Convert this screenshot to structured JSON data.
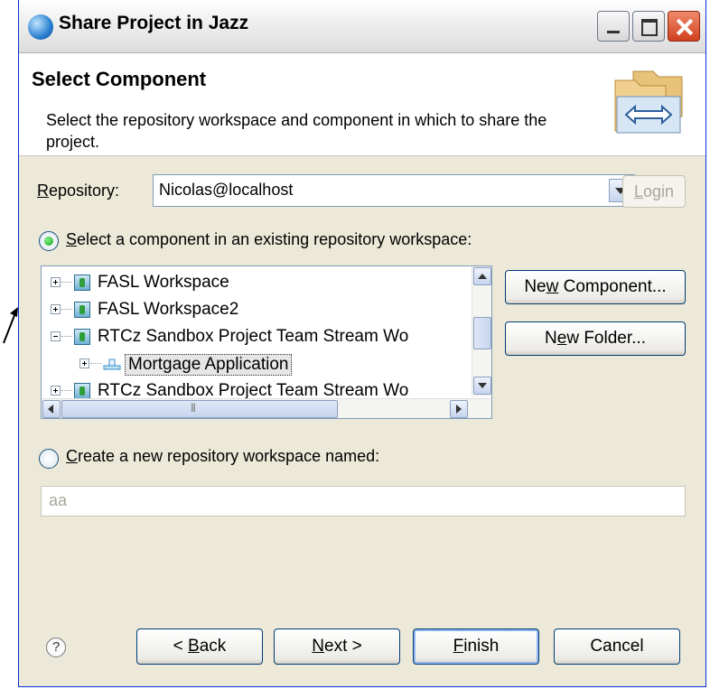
{
  "window": {
    "title": "Share Project in Jazz"
  },
  "banner": {
    "title": "Select Component",
    "description": "Select the repository workspace and component in which to share the project."
  },
  "repository": {
    "label_prefix": "",
    "label_mnemonic": "R",
    "label_rest": "epository:",
    "value": "Nicolas@localhost",
    "login_mnemonic": "L",
    "login_rest": "ogin"
  },
  "option_existing": {
    "mnemonic": "S",
    "label_rest": "elect a component in an existing repository workspace:",
    "selected": true
  },
  "tree": {
    "items": [
      {
        "label": "FASL Workspace",
        "level": 0,
        "expanded": false,
        "kind": "workspace"
      },
      {
        "label": "FASL Workspace2",
        "level": 0,
        "expanded": false,
        "kind": "workspace"
      },
      {
        "label": "RTCz Sandbox Project Team Stream Wo",
        "level": 0,
        "expanded": true,
        "kind": "workspace"
      },
      {
        "label": "Mortgage Application",
        "level": 1,
        "expanded": false,
        "kind": "component",
        "selected": true
      },
      {
        "label": "RTCz Sandbox Project Team Stream Wo",
        "level": 0,
        "expanded": false,
        "kind": "workspace"
      }
    ]
  },
  "side_buttons": {
    "new_component": {
      "pre": "Ne",
      "mnemonic": "w",
      "post": " Component..."
    },
    "new_folder": {
      "pre": "N",
      "mnemonic": "e",
      "post": "w Folder..."
    }
  },
  "option_new": {
    "mnemonic": "C",
    "label_rest": "reate a new repository workspace named:",
    "selected": false,
    "value": "aa"
  },
  "footer": {
    "help": "?",
    "back": {
      "pre": "< ",
      "mnemonic": "B",
      "post": "ack"
    },
    "next": {
      "pre": "",
      "mnemonic": "N",
      "post": "ext >"
    },
    "finish": {
      "pre": "",
      "mnemonic": "F",
      "post": "inish"
    },
    "cancel": "Cancel"
  },
  "colors": {
    "dialog_bg": "#ece9d8",
    "border_blue": "#0831d9",
    "selection_bg": "#e6e6e6"
  }
}
